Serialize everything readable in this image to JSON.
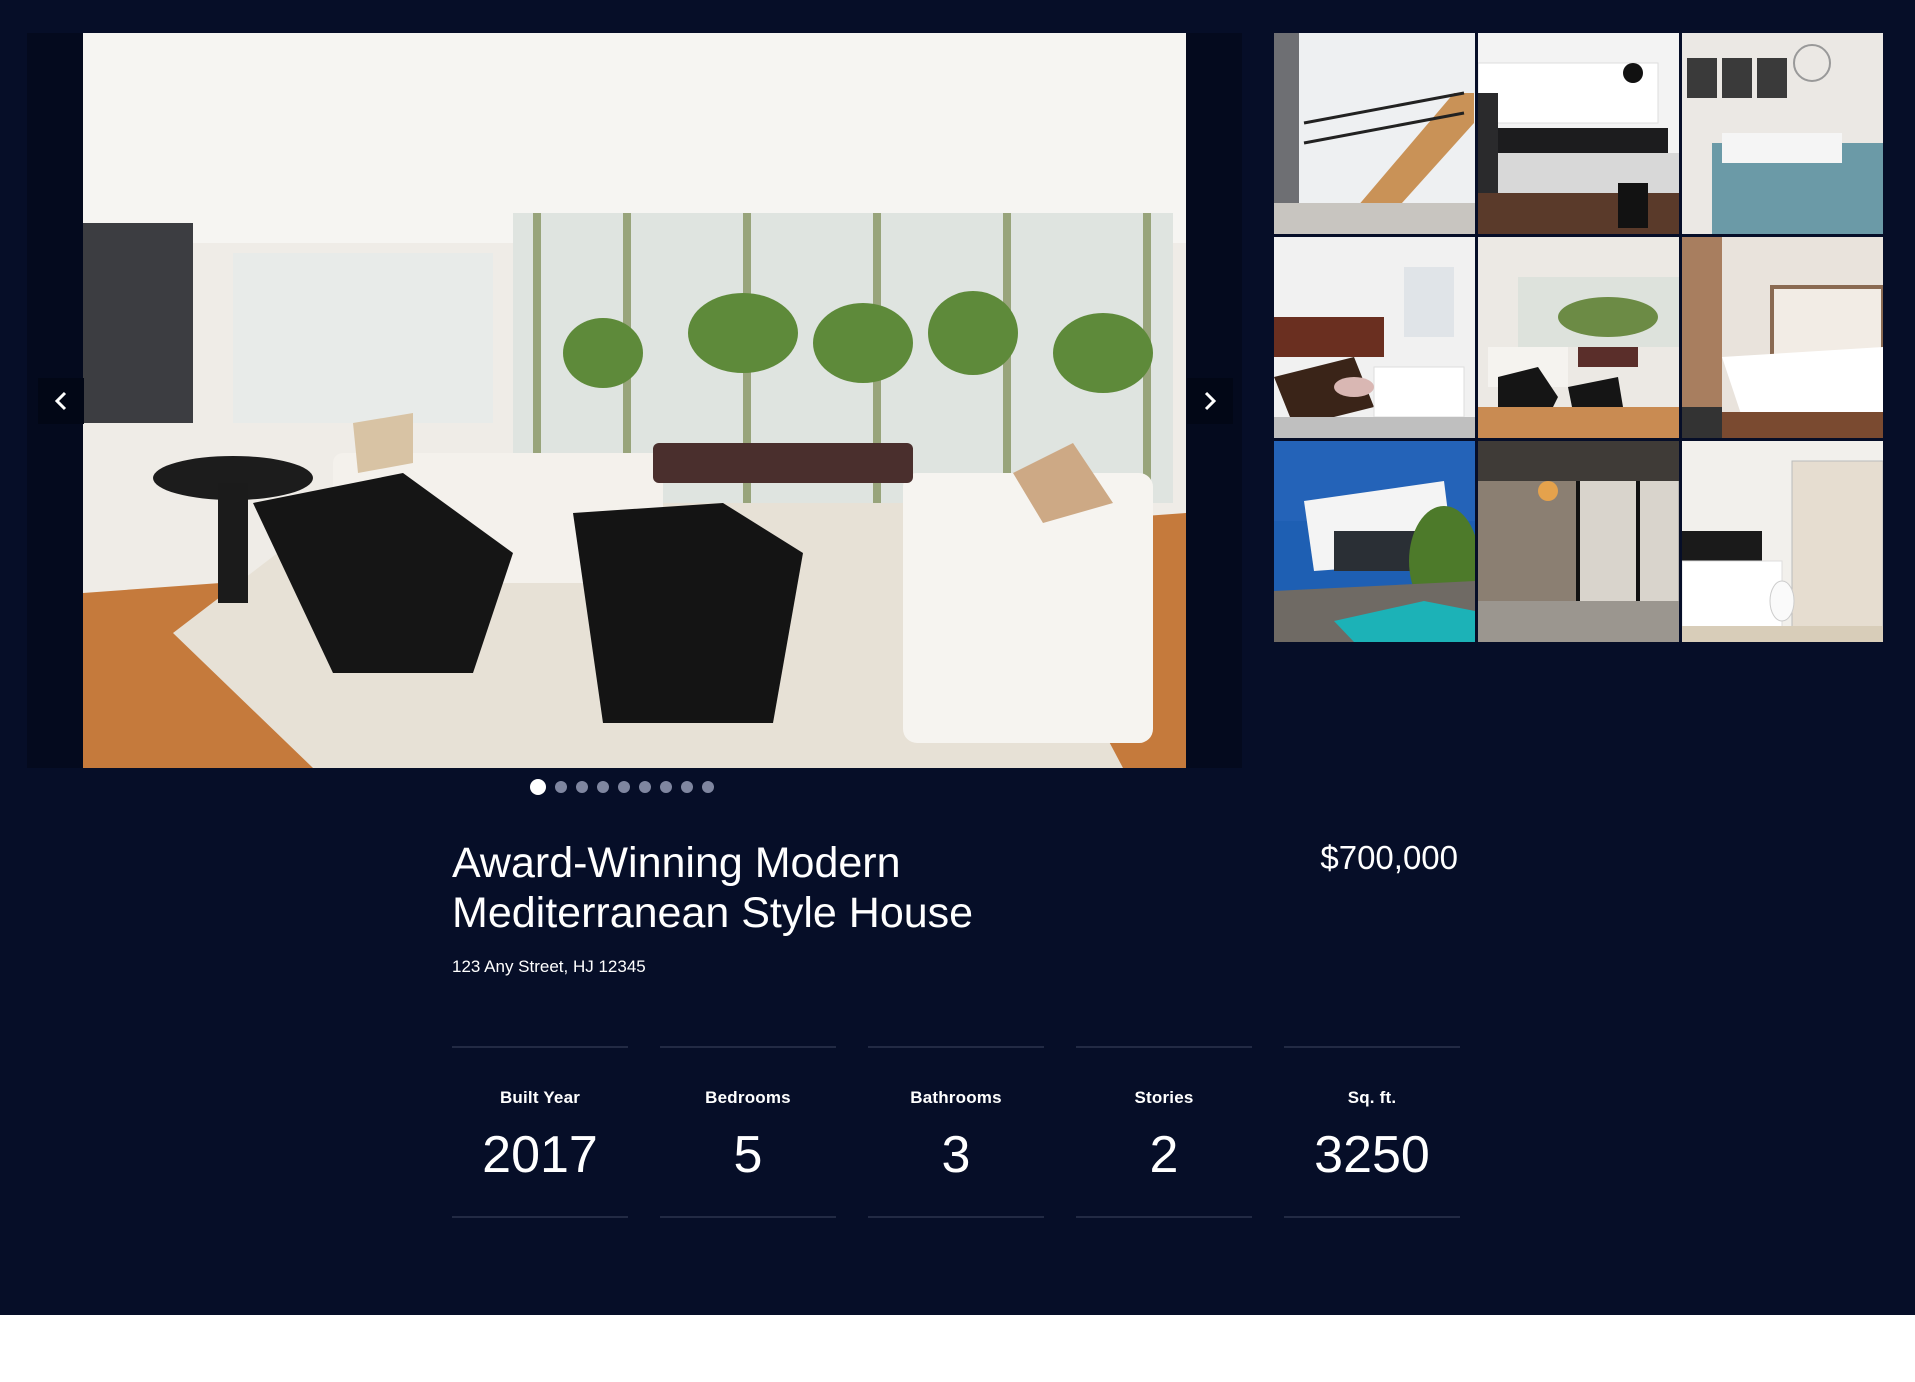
{
  "gallery": {
    "slide_count": 9,
    "active_slide": 0,
    "prev_label": "previous",
    "next_label": "next"
  },
  "listing": {
    "title": "Award-Winning Modern Mediterranean Style House",
    "price": "$700,000",
    "address": "123 Any Street, HJ 12345"
  },
  "stats": [
    {
      "label": "Built Year",
      "value": "2017"
    },
    {
      "label": "Bedrooms",
      "value": "5"
    },
    {
      "label": "Bathrooms",
      "value": "3"
    },
    {
      "label": "Stories",
      "value": "2"
    },
    {
      "label": "Sq. ft.",
      "value": "3250"
    }
  ],
  "colors": {
    "background": "#060e28",
    "dot_inactive": "#7f86a0",
    "dot_active": "#ffffff",
    "divider": "#222a44"
  }
}
